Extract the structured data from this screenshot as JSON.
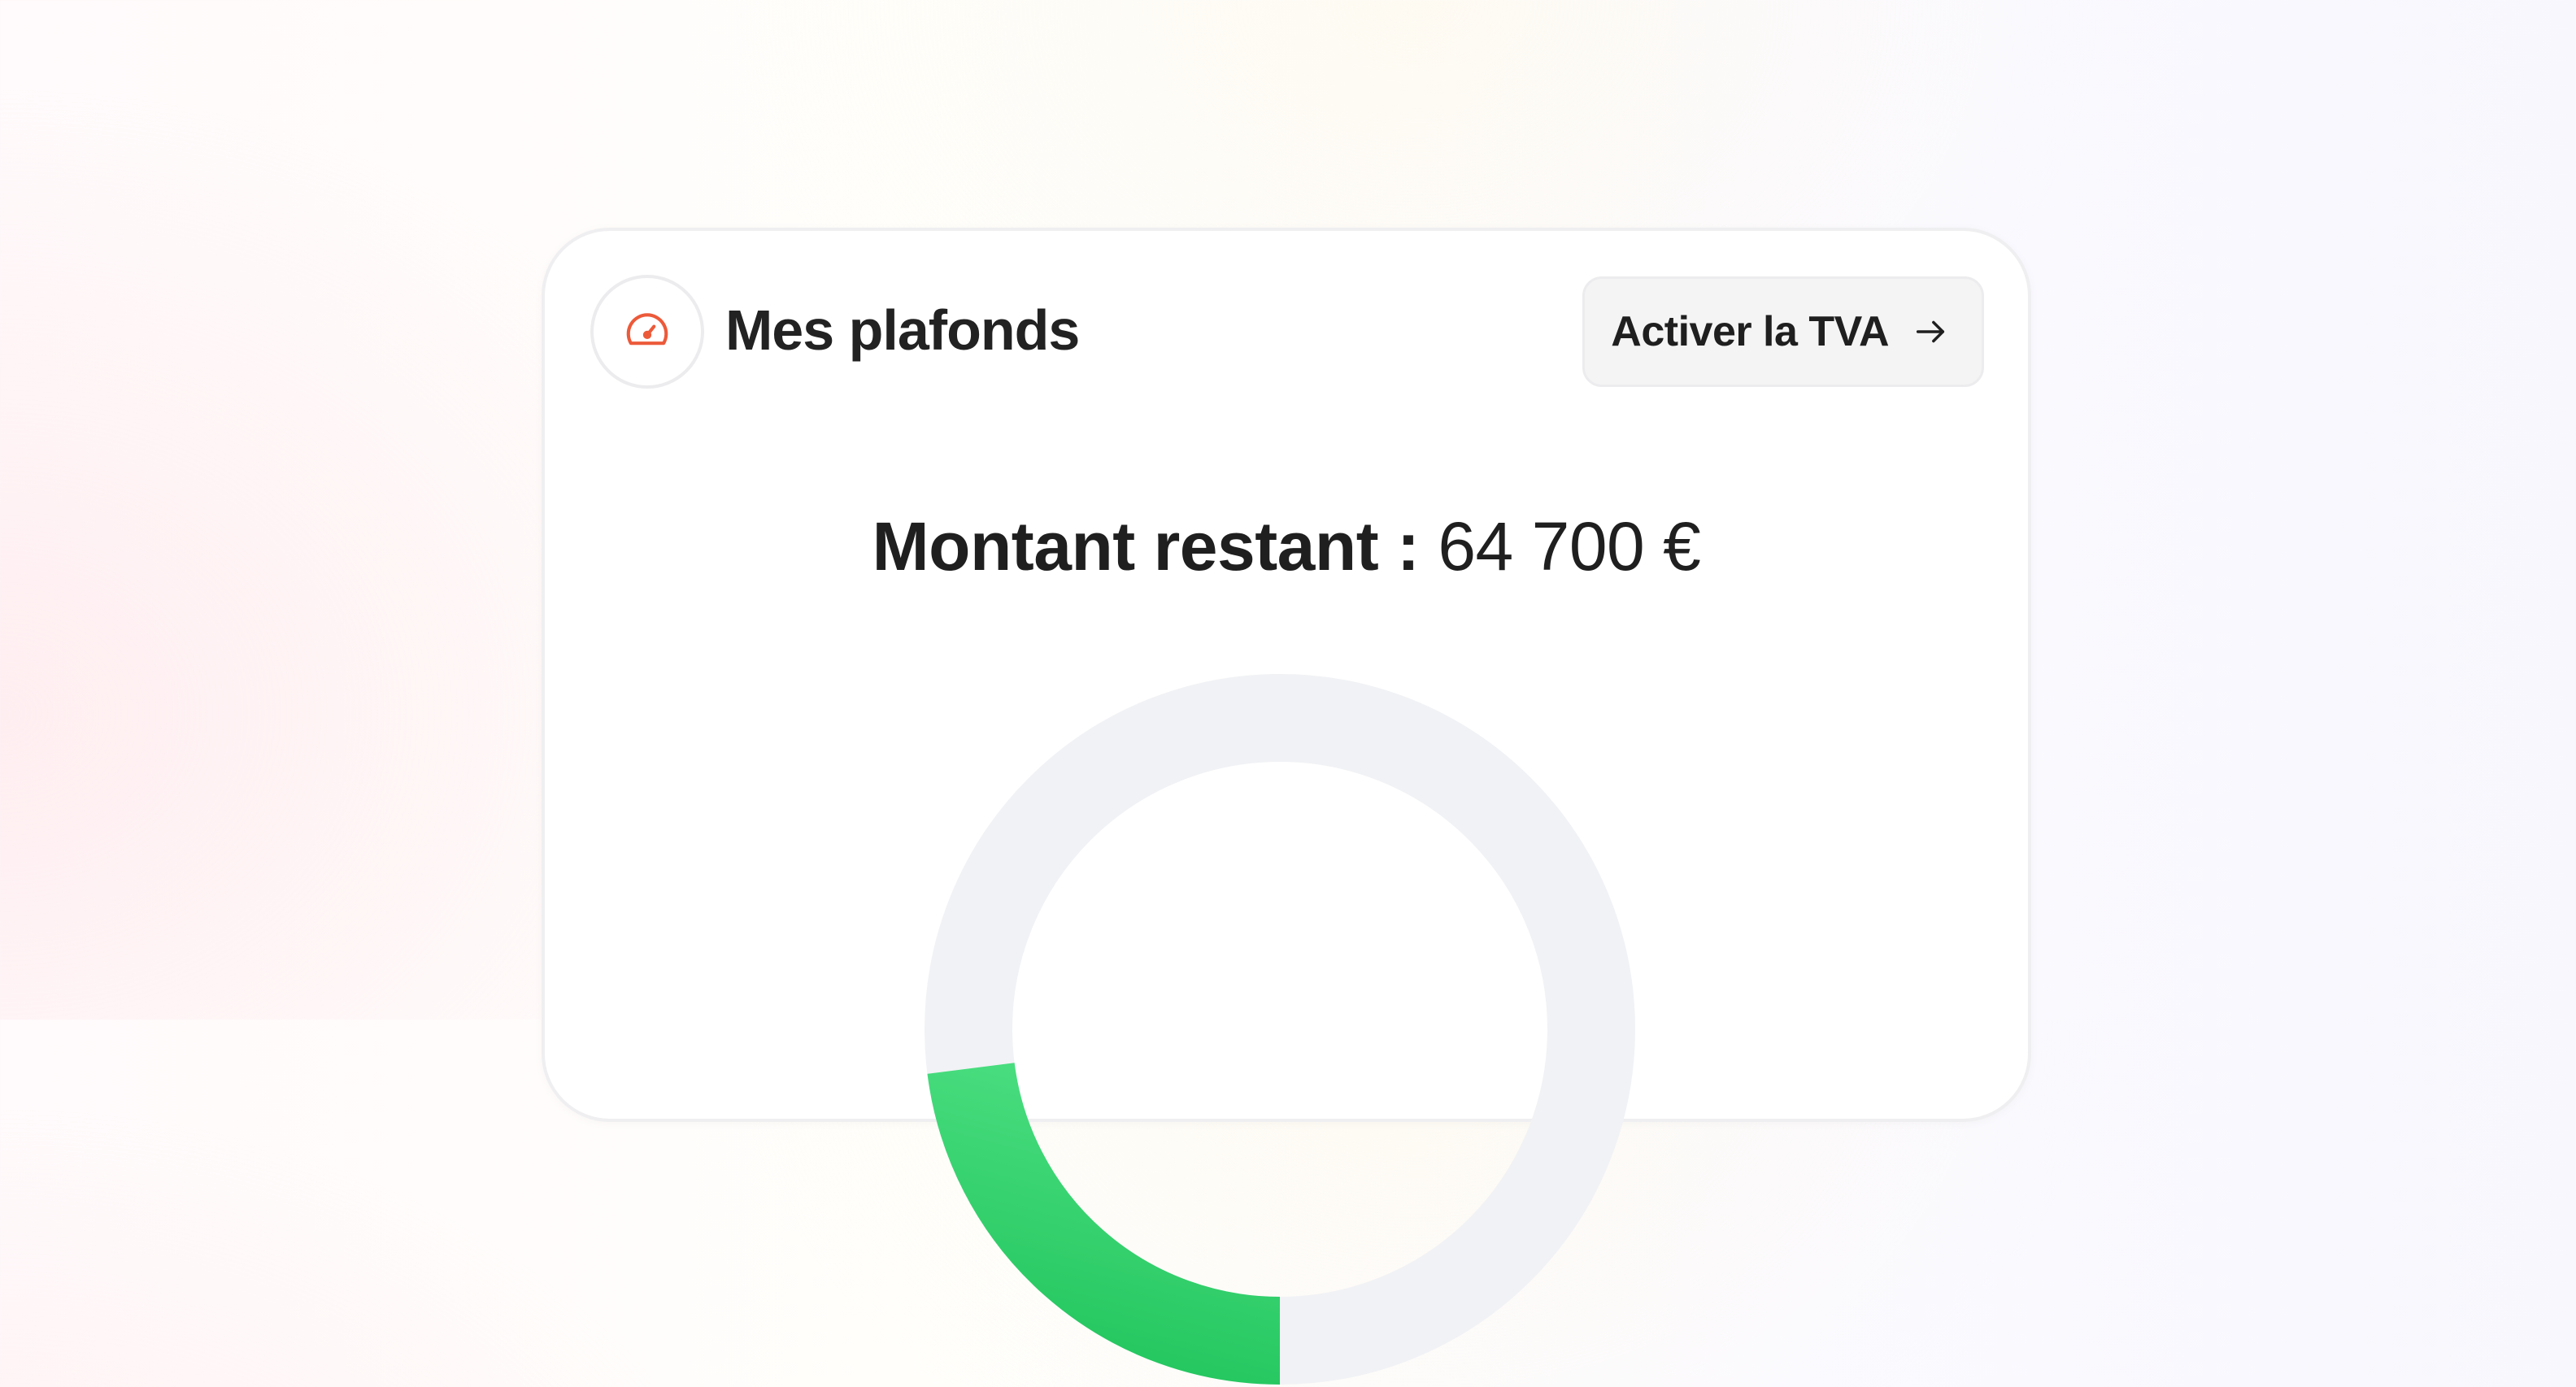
{
  "card": {
    "title": "Mes plafonds",
    "header_icon": "speedometer-icon",
    "action_button": {
      "label": "Activer la TVA",
      "icon": "arrow-right-icon"
    },
    "remaining": {
      "label": "Montant restant :",
      "value": "64 700 €"
    },
    "gauge": {
      "progress_fraction": 0.23,
      "fill_color_start": "#22c55e",
      "fill_color_end": "#4ade80",
      "track_color": "#f1f2f5"
    }
  },
  "colors": {
    "icon_accent": "#ec5a3a"
  }
}
